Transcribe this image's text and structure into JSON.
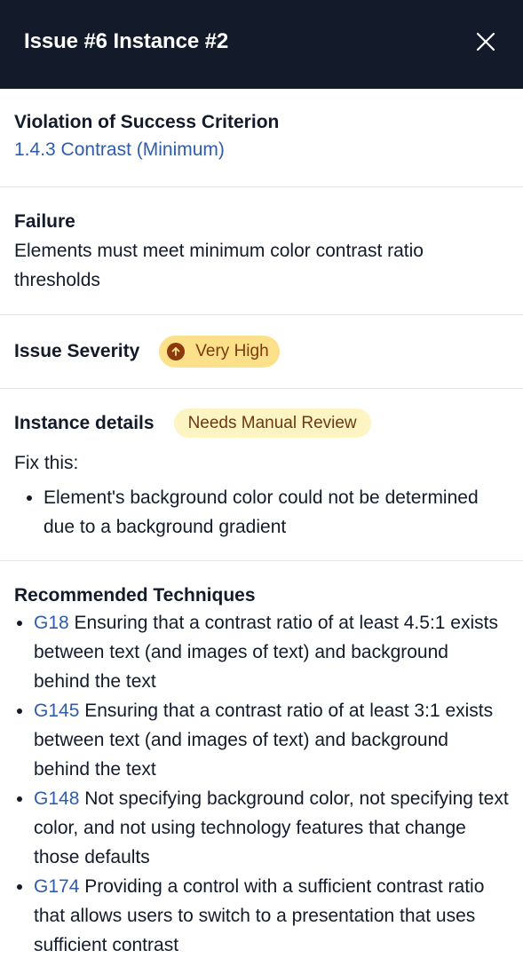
{
  "header": {
    "title": "Issue #6 Instance #2",
    "close_icon": "close-icon"
  },
  "criterion": {
    "label": "Violation of Success Criterion",
    "link": "1.4.3 Contrast (Minimum)"
  },
  "failure": {
    "label": "Failure",
    "text": "Elements must meet minimum color contrast ratio thresholds"
  },
  "severity": {
    "label": "Issue Severity",
    "badge": "Very High",
    "badge_icon": "arrow-up-icon",
    "badge_color": "#fde08a"
  },
  "instance": {
    "label": "Instance details",
    "badge": "Needs Manual Review",
    "fix_label": "Fix this:",
    "fixes": [
      "Element's background color could not be determined due to a background gradient"
    ]
  },
  "techniques": {
    "label": "Recommended Techniques",
    "items": [
      {
        "code": "G18",
        "text": "Ensuring that a contrast ratio of at least 4.5:1 exists between text (and images of text) and background behind the text"
      },
      {
        "code": "G145",
        "text": "Ensuring that a contrast ratio of at least 3:1 exists between text (and images of text) and background behind the text"
      },
      {
        "code": "G148",
        "text": "Not specifying background color, not specifying text color, and not using technology features that change those defaults"
      },
      {
        "code": "G174",
        "text": "Providing a control with a sufficient contrast ratio that allows users to switch to a presentation that uses sufficient contrast"
      }
    ]
  },
  "colors": {
    "header_bg": "#131a2a",
    "link": "#2f5cab",
    "severity_badge": "#fde08a",
    "review_badge": "#fdf4c4"
  }
}
